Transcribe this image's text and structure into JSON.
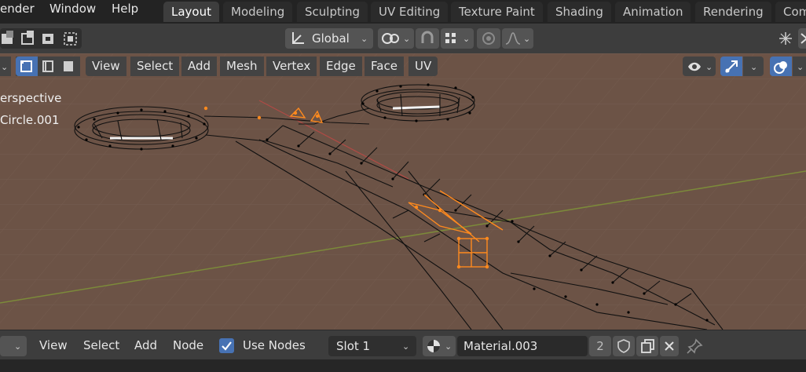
{
  "menu": {
    "render": "ender",
    "window": "Window",
    "help": "Help"
  },
  "workspaces": [
    "Layout",
    "Modeling",
    "Sculpting",
    "UV Editing",
    "Texture Paint",
    "Shading",
    "Animation",
    "Rendering",
    "Com"
  ],
  "header": {
    "orientation": "Global"
  },
  "viewport_menu": [
    "View",
    "Select",
    "Add",
    "Mesh",
    "Vertex",
    "Edge",
    "Face",
    "UV"
  ],
  "overlay_text": {
    "view_mode": "erspective",
    "object_name": "Circle.001"
  },
  "bottom_header": {
    "menus": [
      "View",
      "Select",
      "Add",
      "Node"
    ],
    "use_nodes_label": "Use Nodes",
    "use_nodes_checked": true,
    "slot": "Slot 1",
    "material": "Material.003",
    "users": "2"
  },
  "colors": {
    "accent": "#4772b3",
    "viewport_bg": "#6c5346",
    "selected": "#ff8a1e",
    "wire": "#101010"
  },
  "icons": [
    "object-mode-icon",
    "transform-pivot-icon",
    "snap-icon",
    "proportional-edit-icon",
    "falloff-icon",
    "visibility-icon",
    "gizmo-icon",
    "overlay-icon",
    "shading-icon",
    "material-sphere-icon",
    "shield-icon",
    "duplicate-icon",
    "close-icon",
    "pin-icon",
    "checkbox-icon",
    "select-mode-icons"
  ]
}
